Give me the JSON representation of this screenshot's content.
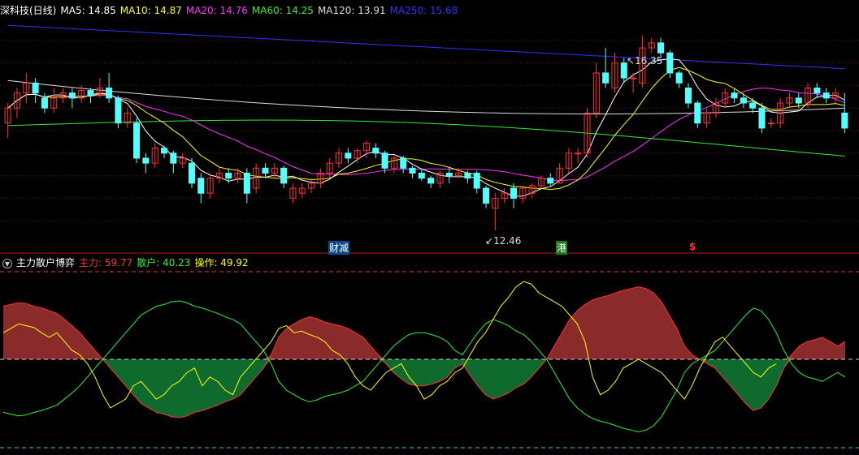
{
  "main": {
    "title": "深科技(日线)",
    "ma_labels": [
      {
        "text": "MA5: 14.85",
        "color": "#ffffff"
      },
      {
        "text": "MA10: 14.87",
        "color": "#ffff00"
      },
      {
        "text": "MA20: 14.76",
        "color": "#ff33ff"
      },
      {
        "text": "MA60: 14.25",
        "color": "#33ee33"
      },
      {
        "text": "MA120: 13.91",
        "color": "#dddddd"
      },
      {
        "text": "MA250: 15.68",
        "color": "#3333ff"
      }
    ],
    "high_label": "16.35",
    "low_label": "12.46",
    "events": [
      {
        "text": "财减",
        "color": "#ffffff",
        "bg": "#0a4a8a"
      },
      {
        "text": "港",
        "color": "#ffffff",
        "bg": "#1a7a1a"
      },
      {
        "text": "$",
        "color": "#ff3333",
        "bg": "transparent"
      }
    ]
  },
  "indicator": {
    "title": "主力散户博弈",
    "values": [
      {
        "label": "主力:",
        "value": "59.77",
        "color": "#ff3333"
      },
      {
        "label": "散户:",
        "value": "40.23",
        "color": "#33ee33"
      },
      {
        "label": "操作:",
        "value": "49.92",
        "color": "#ffff00"
      }
    ]
  },
  "colors": {
    "up": "#ff3333",
    "down": "#54ffff",
    "red_fill": "#8b2a2a",
    "green_fill": "#0f6a2e",
    "grid": "#7a1010",
    "zero": "#cccccc",
    "cyan_dash": "#33cccc"
  },
  "chart_data": [
    {
      "type": "candlestick",
      "title": "深科技(日线)",
      "ylim": [
        12.2,
        16.7
      ],
      "candles": [
        [
          14.6,
          14.9,
          15.0,
          14.3
        ],
        [
          14.9,
          15.2,
          15.3,
          14.7
        ],
        [
          15.2,
          15.4,
          15.6,
          15.0
        ],
        [
          15.4,
          15.2,
          15.5,
          15.0
        ],
        [
          15.1,
          14.9,
          15.2,
          14.8
        ],
        [
          14.9,
          15.1,
          15.3,
          14.8
        ],
        [
          15.1,
          15.2,
          15.3,
          15.0
        ],
        [
          15.2,
          15.1,
          15.3,
          14.9
        ],
        [
          15.1,
          15.25,
          15.35,
          15.0
        ],
        [
          15.25,
          15.15,
          15.3,
          15.0
        ],
        [
          15.2,
          15.3,
          15.5,
          15.1
        ],
        [
          15.3,
          15.1,
          15.6,
          15.0
        ],
        [
          15.1,
          14.6,
          15.15,
          14.5
        ],
        [
          14.6,
          14.8,
          14.9,
          14.5
        ],
        [
          14.6,
          13.9,
          14.7,
          13.8
        ],
        [
          13.9,
          13.8,
          14.0,
          13.6
        ],
        [
          13.8,
          14.1,
          14.2,
          13.7
        ],
        [
          14.1,
          14.0,
          14.15,
          13.9
        ],
        [
          14.0,
          13.8,
          14.05,
          13.6
        ],
        [
          13.8,
          13.9,
          14.0,
          13.7
        ],
        [
          13.8,
          13.4,
          13.9,
          13.3
        ],
        [
          13.5,
          13.2,
          13.6,
          13.0
        ],
        [
          13.2,
          13.5,
          13.6,
          13.1
        ],
        [
          13.5,
          13.6,
          13.7,
          13.4
        ],
        [
          13.6,
          13.5,
          13.7,
          13.4
        ],
        [
          13.5,
          13.6,
          13.7,
          13.4
        ],
        [
          13.6,
          13.2,
          13.7,
          13.0
        ],
        [
          13.3,
          13.7,
          13.8,
          13.2
        ],
        [
          13.7,
          13.6,
          13.8,
          13.5
        ],
        [
          13.6,
          13.7,
          13.8,
          13.5
        ],
        [
          13.7,
          13.4,
          13.75,
          13.3
        ],
        [
          13.1,
          13.3,
          13.4,
          13.0
        ],
        [
          13.2,
          13.3,
          13.4,
          13.1
        ],
        [
          13.3,
          13.4,
          13.5,
          13.2
        ],
        [
          13.4,
          13.6,
          13.7,
          13.3
        ],
        [
          13.6,
          13.8,
          13.9,
          13.5
        ],
        [
          13.8,
          14.0,
          14.1,
          13.7
        ],
        [
          14.0,
          13.9,
          14.1,
          13.8
        ],
        [
          13.9,
          14.05,
          14.1,
          13.8
        ],
        [
          14.05,
          14.2,
          14.25,
          13.9
        ],
        [
          14.1,
          14.0,
          14.2,
          13.9
        ],
        [
          14.0,
          13.7,
          14.05,
          13.6
        ],
        [
          13.7,
          13.9,
          13.95,
          13.6
        ],
        [
          13.9,
          13.7,
          13.95,
          13.6
        ],
        [
          13.7,
          13.6,
          13.75,
          13.5
        ],
        [
          13.6,
          13.5,
          13.7,
          13.45
        ],
        [
          13.5,
          13.4,
          13.55,
          13.3
        ],
        [
          13.4,
          13.6,
          13.65,
          13.3
        ],
        [
          13.6,
          13.55,
          13.7,
          13.4
        ],
        [
          13.55,
          13.6,
          13.7,
          13.5
        ],
        [
          13.6,
          13.5,
          13.65,
          13.4
        ],
        [
          13.6,
          13.3,
          13.65,
          13.2
        ],
        [
          13.3,
          13.0,
          13.35,
          12.9
        ],
        [
          12.9,
          13.1,
          13.2,
          12.46
        ],
        [
          13.1,
          13.2,
          13.3,
          13.0
        ],
        [
          13.3,
          13.1,
          13.4,
          12.9
        ],
        [
          13.1,
          13.3,
          13.35,
          13.0
        ],
        [
          13.2,
          13.35,
          13.4,
          13.1
        ],
        [
          13.35,
          13.5,
          13.55,
          13.3
        ],
        [
          13.5,
          13.4,
          13.6,
          13.35
        ],
        [
          13.4,
          13.7,
          13.8,
          13.4
        ],
        [
          13.7,
          14.0,
          14.1,
          13.6
        ],
        [
          14.0,
          14.0,
          14.1,
          13.8
        ],
        [
          14.0,
          14.8,
          14.9,
          13.9
        ],
        [
          14.8,
          15.6,
          15.8,
          14.7
        ],
        [
          15.6,
          15.4,
          16.1,
          15.3
        ],
        [
          15.3,
          15.8,
          16.0,
          15.2
        ],
        [
          15.8,
          15.5,
          15.9,
          15.4
        ],
        [
          15.5,
          15.5,
          15.6,
          15.2
        ],
        [
          15.4,
          16.1,
          16.35,
          15.3
        ],
        [
          16.1,
          16.2,
          16.3,
          16.0
        ],
        [
          16.2,
          16.0,
          16.3,
          15.9
        ],
        [
          16.0,
          15.6,
          16.05,
          15.5
        ],
        [
          15.6,
          15.4,
          15.65,
          15.3
        ],
        [
          15.3,
          15.0,
          15.4,
          14.9
        ],
        [
          15.0,
          14.6,
          15.05,
          14.5
        ],
        [
          14.6,
          14.8,
          14.9,
          14.5
        ],
        [
          14.8,
          15.0,
          15.1,
          14.7
        ],
        [
          15.0,
          15.2,
          15.3,
          14.9
        ],
        [
          15.2,
          15.1,
          15.3,
          15.0
        ],
        [
          15.1,
          15.0,
          15.2,
          14.9
        ],
        [
          15.0,
          14.9,
          15.1,
          14.8
        ],
        [
          14.9,
          14.5,
          15.0,
          14.4
        ],
        [
          14.6,
          14.6,
          14.7,
          14.5
        ],
        [
          14.6,
          15.0,
          15.1,
          14.5
        ],
        [
          15.0,
          15.1,
          15.2,
          14.9
        ],
        [
          15.1,
          15.0,
          15.2,
          14.9
        ],
        [
          15.0,
          15.3,
          15.4,
          14.9
        ],
        [
          15.3,
          15.2,
          15.4,
          15.1
        ],
        [
          15.2,
          15.1,
          15.3,
          15.0
        ],
        [
          15.1,
          15.2,
          15.3,
          15.0
        ],
        [
          14.8,
          14.5,
          15.2,
          14.4
        ]
      ]
    },
    {
      "type": "area",
      "title": "主力散户博弈",
      "ylim": [
        -100,
        100
      ],
      "x_count": 96,
      "series": [
        {
          "name": "主力",
          "values": [
            60,
            62,
            64,
            63,
            60,
            58,
            55,
            52,
            45,
            38,
            30,
            20,
            10,
            0,
            -10,
            -20,
            -30,
            -40,
            -50,
            -55,
            -60,
            -62,
            -65,
            -66,
            -64,
            -60,
            -58,
            -55,
            -52,
            -48,
            -45,
            -40,
            -30,
            -20,
            -10,
            5,
            25,
            35,
            40,
            45,
            48,
            46,
            42,
            40,
            38,
            35,
            30,
            25,
            15,
            5,
            -5,
            -15,
            -22,
            -28,
            -30,
            -30,
            -28,
            -25,
            -20,
            -10,
            -5,
            -18,
            -30,
            -40,
            -45,
            -42,
            -38,
            -32,
            -28,
            -20,
            -10,
            0,
            15,
            30,
            45,
            55,
            62,
            67,
            70,
            72,
            75,
            78,
            80,
            82,
            80,
            75,
            65,
            50,
            35,
            15,
            5,
            0,
            -5,
            -10,
            -20,
            -30,
            -40,
            -50,
            -58,
            -55,
            -45,
            -30,
            -10,
            5,
            15,
            20,
            22,
            25,
            20,
            15,
            20
          ]
        },
        {
          "name": "散户",
          "values": [
            -60,
            -62,
            -64,
            -63,
            -60,
            -58,
            -55,
            -52,
            -45,
            -38,
            -30,
            -20,
            -10,
            0,
            10,
            20,
            30,
            40,
            50,
            55,
            60,
            62,
            65,
            66,
            64,
            60,
            58,
            55,
            52,
            48,
            45,
            40,
            30,
            20,
            10,
            -5,
            -25,
            -35,
            -40,
            -45,
            -48,
            -46,
            -42,
            -40,
            -38,
            -35,
            -30,
            -25,
            -15,
            -5,
            5,
            15,
            22,
            28,
            30,
            30,
            28,
            25,
            20,
            10,
            5,
            18,
            30,
            40,
            45,
            42,
            38,
            32,
            28,
            20,
            10,
            0,
            -15,
            -30,
            -45,
            -55,
            -62,
            -67,
            -70,
            -72,
            -75,
            -78,
            -80,
            -82,
            -80,
            -75,
            -65,
            -50,
            -35,
            -15,
            -5,
            0,
            5,
            10,
            20,
            30,
            40,
            50,
            58,
            55,
            45,
            30,
            10,
            -5,
            -15,
            -20,
            -22,
            -25,
            -20,
            -15,
            -20
          ]
        },
        {
          "name": "操作",
          "values": [
            30,
            35,
            40,
            38,
            36,
            30,
            25,
            30,
            20,
            10,
            5,
            -5,
            -20,
            -40,
            -55,
            -50,
            -45,
            -30,
            -25,
            -35,
            -45,
            -40,
            -30,
            -25,
            -15,
            -10,
            -30,
            -20,
            -25,
            -35,
            -40,
            -20,
            -10,
            0,
            10,
            20,
            35,
            38,
            30,
            32,
            28,
            25,
            20,
            10,
            5,
            -5,
            -20,
            -30,
            -35,
            -25,
            -15,
            -10,
            -5,
            -20,
            -30,
            -45,
            -40,
            -30,
            -25,
            -15,
            -10,
            5,
            20,
            30,
            45,
            60,
            70,
            82,
            88,
            85,
            75,
            70,
            65,
            60,
            50,
            40,
            20,
            -20,
            -40,
            -35,
            -25,
            -10,
            -5,
            0,
            -5,
            -10,
            -15,
            -25,
            -35,
            -45,
            -30,
            -10,
            5,
            20,
            25,
            15,
            5,
            -5,
            -15,
            -20,
            -10,
            -5
          ]
        }
      ]
    }
  ]
}
